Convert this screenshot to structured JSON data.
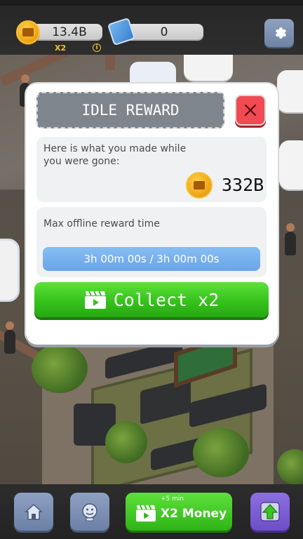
{
  "top_bar": {
    "money_value": "13.4B",
    "money_multiplier": "X2",
    "info_glyph": "i",
    "gems_value": "0",
    "icons": {
      "money": "coin-icon",
      "gems": "gem-icon",
      "settings": "gear-icon",
      "info": "info-icon"
    }
  },
  "modal": {
    "title": "IDLE REWARD",
    "close_glyph": "×",
    "earnings_text": "Here is what you made while you were gone:",
    "earnings_value": "332B",
    "max_time_label": "Max offline reward time",
    "time_progress_text": "3h 00m 00s / 3h 00m 00s",
    "time_progress_fraction": 1.0,
    "collect_label": "Collect x2",
    "icons": {
      "close": "close-icon",
      "earnings": "coin-icon",
      "collect": "video-ad-icon"
    }
  },
  "bottom_bar": {
    "money_boost_label": "X2 Money",
    "money_boost_sub": "+5 min",
    "icons": [
      "home-icon",
      "manager-face-icon",
      "video-ad-icon",
      "upgrade-arrow-icon"
    ]
  },
  "colors": {
    "collect_green": "#35c21b",
    "close_red": "#f04a52",
    "progress_blue": "#6aa5e8",
    "coin_gold": "#f0a81a",
    "settings_blue": "#6f83a5",
    "upgrade_purple": "#6b4fc6"
  }
}
